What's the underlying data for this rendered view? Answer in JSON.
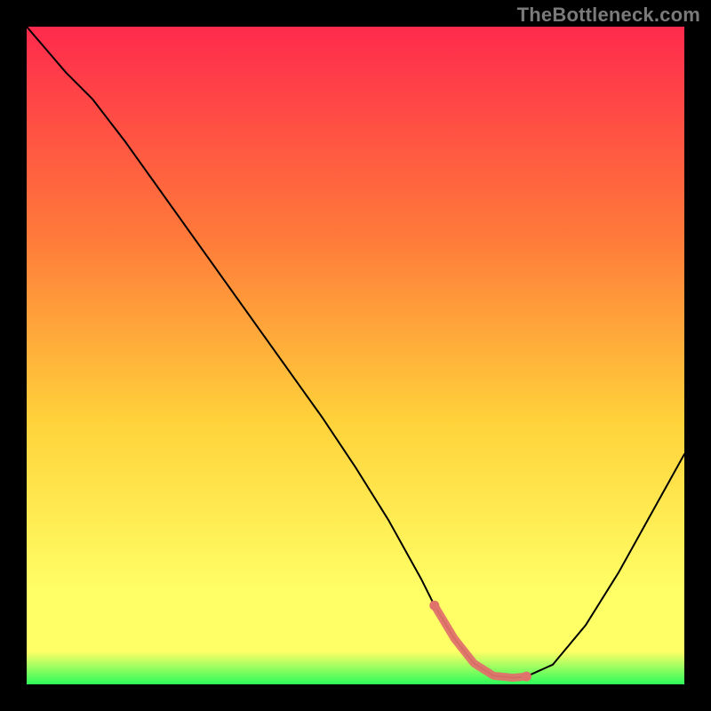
{
  "watermark": "TheBottleneck.com",
  "colors": {
    "gradient_top": "#ff2a4d",
    "gradient_mid_upper": "#ff7a3a",
    "gradient_mid": "#ffd23a",
    "gradient_lower": "#ffff66",
    "gradient_bottom": "#2dfc5a",
    "curve": "#000000",
    "highlight": "#e0726c",
    "frame": "#000000"
  },
  "chart_data": {
    "type": "line",
    "title": "",
    "xlabel": "",
    "ylabel": "",
    "xlim": [
      0,
      100
    ],
    "ylim": [
      0,
      100
    ],
    "x": [
      0,
      6,
      10,
      15,
      20,
      25,
      30,
      35,
      40,
      45,
      50,
      55,
      60,
      62,
      65,
      68,
      71,
      74,
      76,
      80,
      85,
      90,
      95,
      100
    ],
    "y": [
      100,
      93,
      89,
      82.5,
      75.5,
      68.5,
      61.5,
      54.5,
      47.5,
      40.5,
      33,
      25,
      16,
      12,
      7,
      3.2,
      1.3,
      1.0,
      1.2,
      3.0,
      9,
      17,
      26,
      35
    ],
    "highlight_range_x": [
      62,
      76
    ],
    "highlight_y": 1.1
  }
}
